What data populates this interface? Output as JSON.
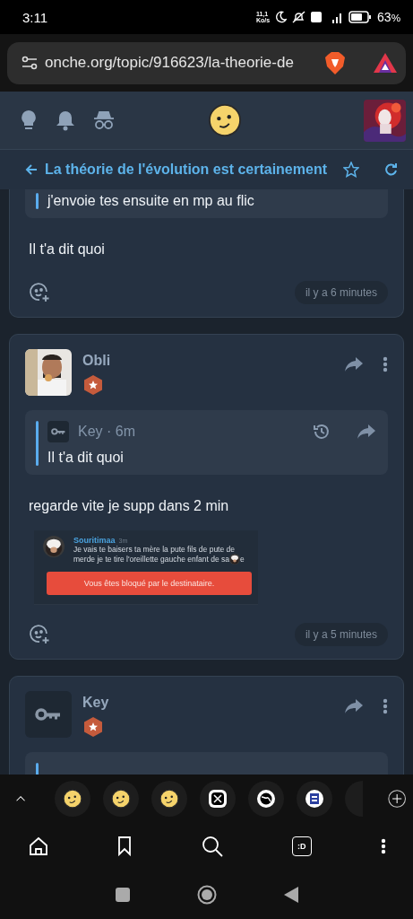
{
  "status_bar": {
    "time": "3:11",
    "net_speed": "11,1",
    "net_unit": "Ko/s",
    "battery": "63",
    "battery_unit": "%"
  },
  "browser": {
    "url": "onche.org/topic/916623/la-theorie-de"
  },
  "topic": {
    "title": "La théorie de l'évolution est certainement"
  },
  "posts": [
    {
      "kind": "tail",
      "quote": "j'envoie tes ensuite en mp au flic",
      "body": "Il t'a dit quoi",
      "time": "il y a 6 minutes"
    },
    {
      "kind": "full",
      "author": "Obli",
      "photo_avatar": true,
      "quote": {
        "byline": "Key · 6m",
        "text": "Il t'a dit quoi"
      },
      "body": "regarde vite je supp dans 2 min",
      "embed": {
        "name": "Souritimaa",
        "age": "3m",
        "lines": [
          "Je vais te baisers ta mère la pute fils de pute de",
          "merde je te tire l'oreillette gauche enfant de sa"
        ],
        "tail": "e",
        "alert": "Vous êtes bloqué par le destinataire."
      },
      "time": "il y a 5 minutes"
    },
    {
      "kind": "cut",
      "author": "Key",
      "photo_avatar": false
    }
  ],
  "shortcuts": [
    {
      "kind": "emoji"
    },
    {
      "kind": "emoji"
    },
    {
      "kind": "emoji"
    },
    {
      "kind": "x"
    },
    {
      "kind": "globe"
    },
    {
      "kind": "doc"
    },
    {
      "kind": "partial"
    }
  ],
  "toolbar": {
    "tab_label": ":D"
  }
}
